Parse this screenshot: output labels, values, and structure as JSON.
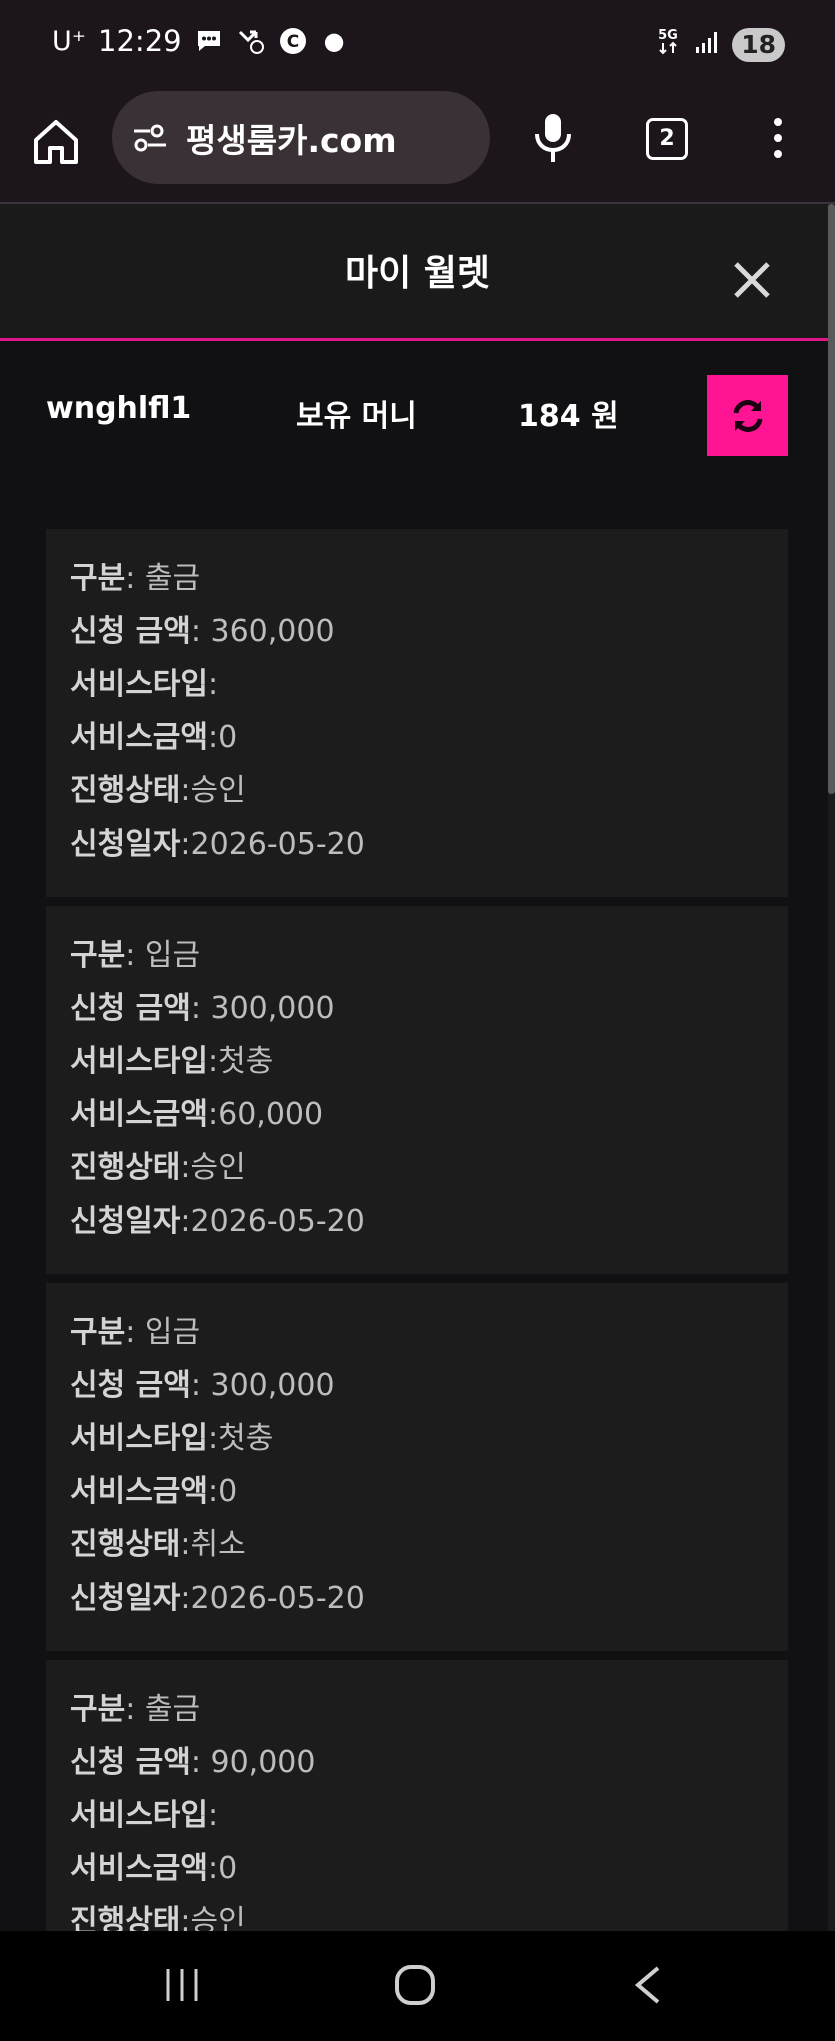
{
  "status_bar": {
    "carrier": "U⁺",
    "time": "12:29",
    "battery": "18",
    "network": "5G",
    "icons": [
      "chat-icon",
      "missed-call-icon",
      "c-app-icon",
      "notification-dot-icon",
      "network-5g-icon",
      "signal-icon",
      "battery-icon"
    ]
  },
  "browser": {
    "url": "평생룸카.com",
    "tab_count": "2",
    "icons": [
      "home-icon",
      "site-settings-icon",
      "mic-icon",
      "tabs-icon",
      "menu-icon"
    ]
  },
  "modal": {
    "title": "마이 월렛",
    "close_icon": "close-icon"
  },
  "wallet": {
    "username": "wnghlfl1",
    "balance_label": "보유 머니",
    "balance": "184 원",
    "refresh_icon": "refresh-icon",
    "accent_color": "#ff1493"
  },
  "transactions": [
    {
      "type_label": "구분",
      "type": ": 출금",
      "amount_label": "신청 금액",
      "amount": ": 360,000",
      "service_type_label": "서비스타입",
      "service_type": ":",
      "service_amount_label": "서비스금액",
      "service_amount": ":0",
      "status_label": "진행상태",
      "status": ":승인",
      "date_label": "신청일자",
      "date": ":2026-05-20"
    },
    {
      "type_label": "구분",
      "type": ": 입금",
      "amount_label": "신청 금액",
      "amount": ": 300,000",
      "service_type_label": "서비스타입",
      "service_type": ":첫충",
      "service_amount_label": "서비스금액",
      "service_amount": ":60,000",
      "status_label": "진행상태",
      "status": ":승인",
      "date_label": "신청일자",
      "date": ":2026-05-20"
    },
    {
      "type_label": "구분",
      "type": ": 입금",
      "amount_label": "신청 금액",
      "amount": ": 300,000",
      "service_type_label": "서비스타입",
      "service_type": ":첫충",
      "service_amount_label": "서비스금액",
      "service_amount": ":0",
      "status_label": "진행상태",
      "status": ":취소",
      "date_label": "신청일자",
      "date": ":2026-05-20"
    },
    {
      "type_label": "구분",
      "type": ": 출금",
      "amount_label": "신청 금액",
      "amount": ": 90,000",
      "service_type_label": "서비스타입",
      "service_type": ":",
      "service_amount_label": "서비스금액",
      "service_amount": ":0",
      "status_label": "진행상태",
      "status": ":승인",
      "date_label": "신청일자",
      "date": ""
    }
  ],
  "nav_bar": {
    "icons": [
      "recent-apps-icon",
      "home-nav-icon",
      "back-icon"
    ]
  }
}
